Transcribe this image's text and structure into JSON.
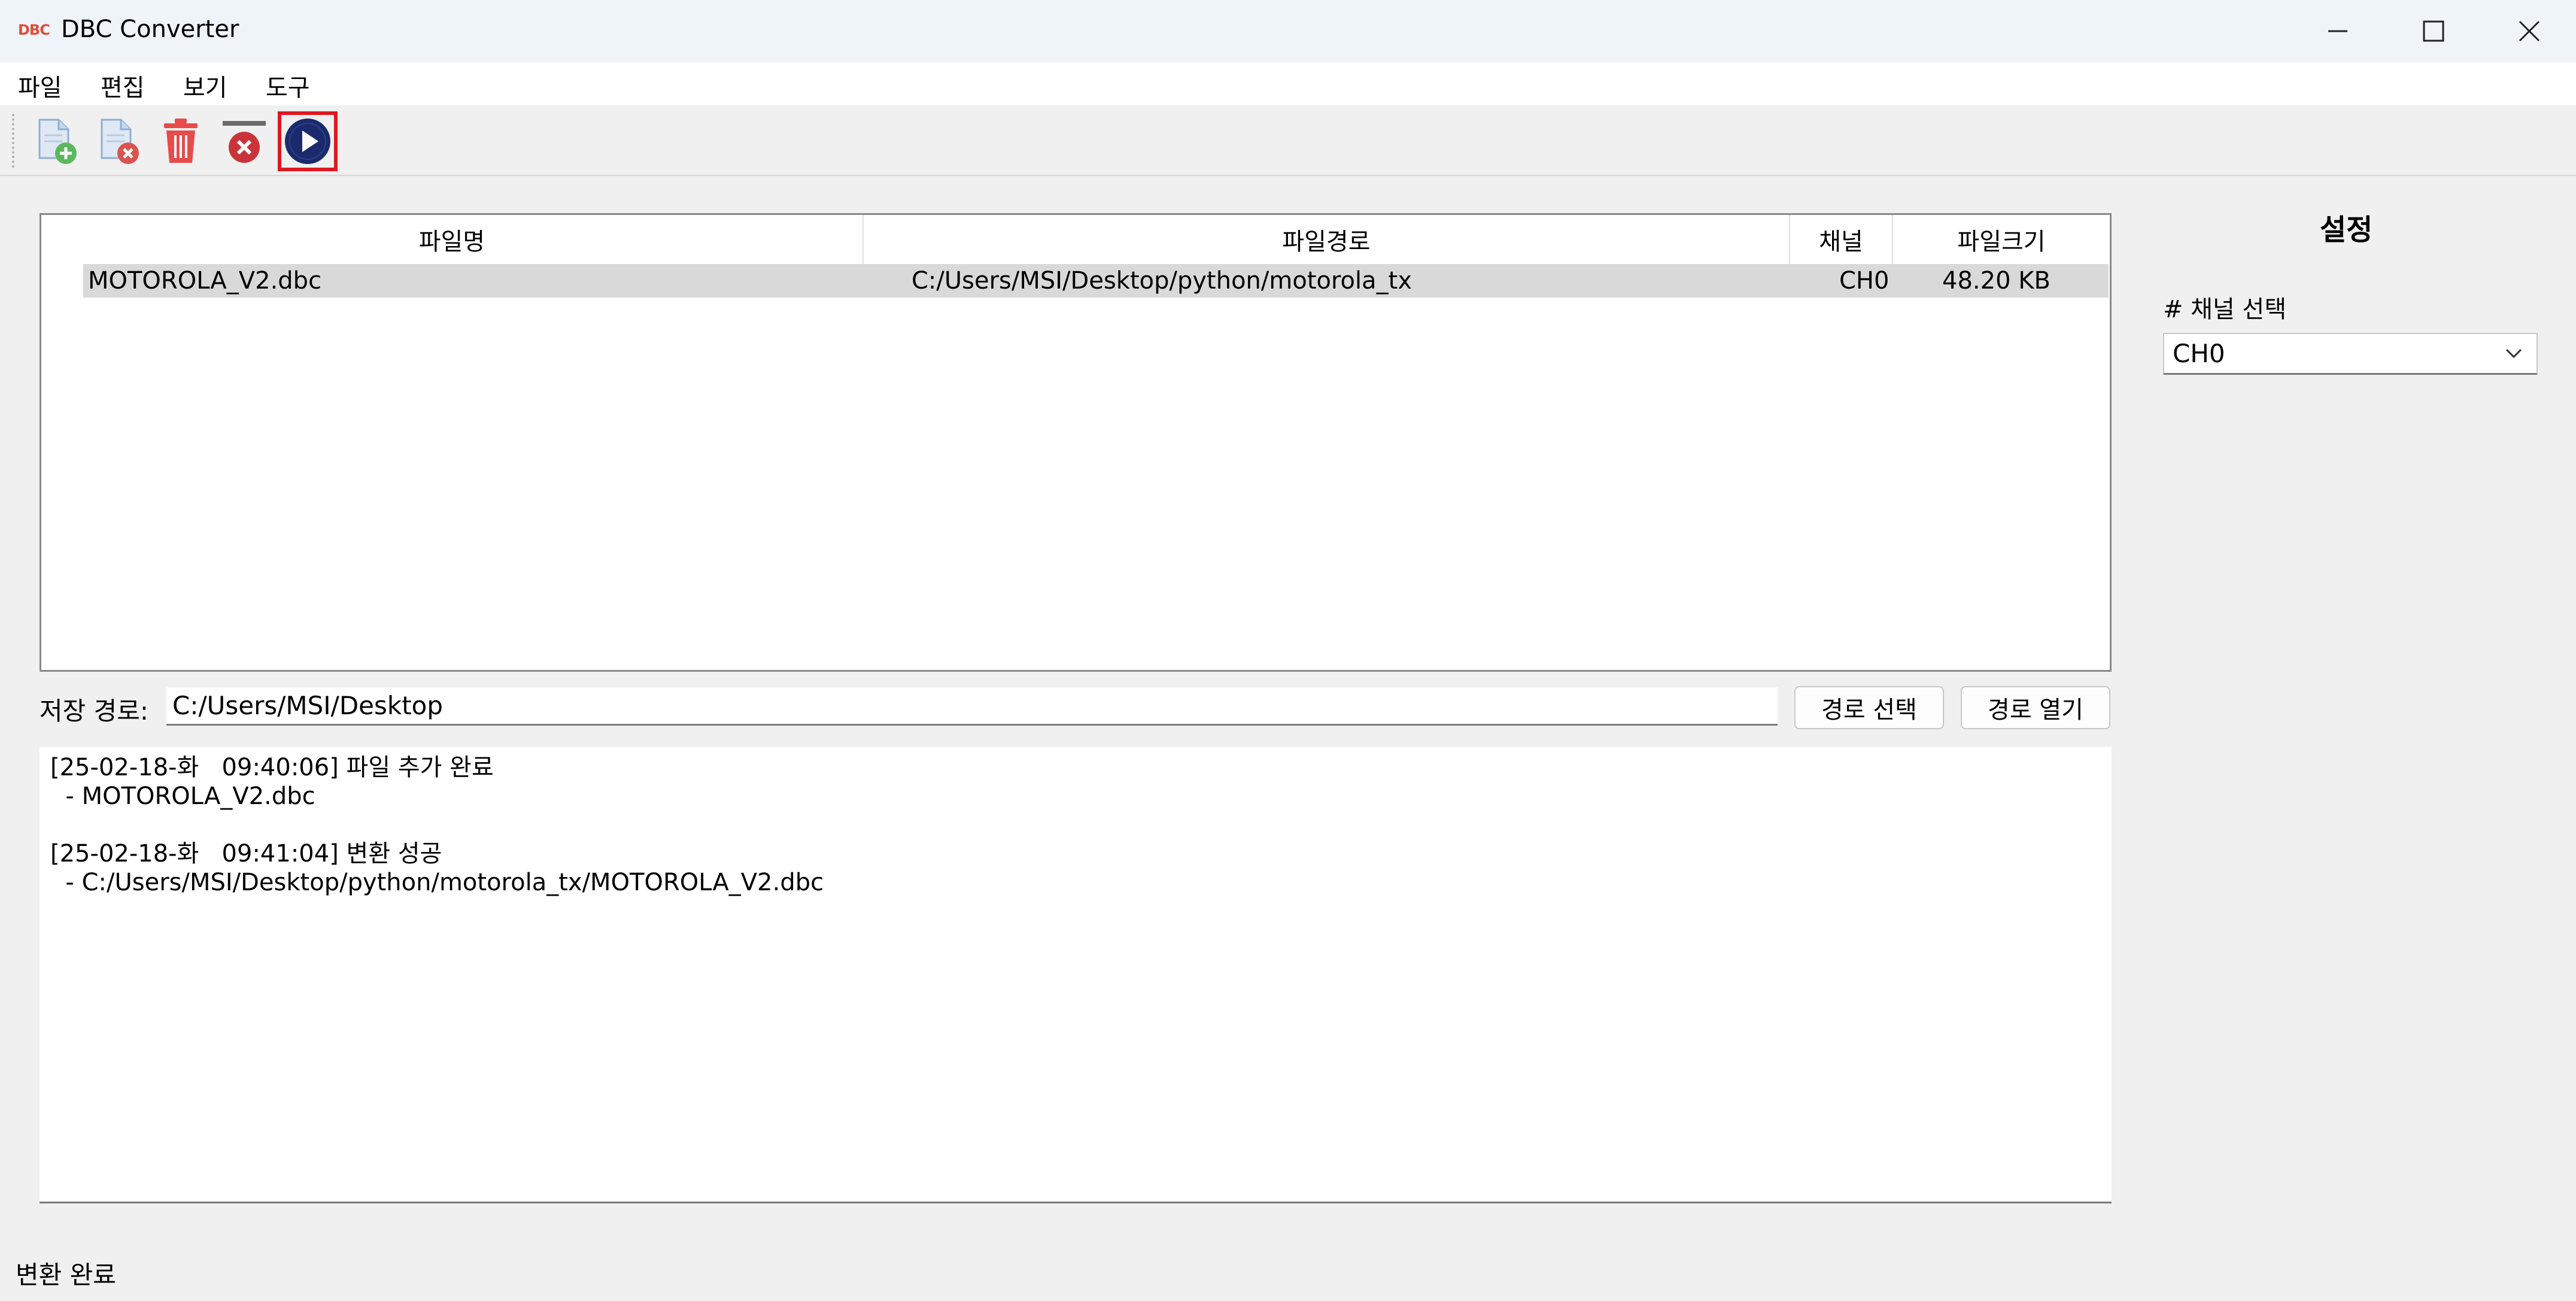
{
  "window": {
    "logo_text": "DBC",
    "title": "DBC Converter",
    "controls": [
      "minimize",
      "maximize",
      "close"
    ]
  },
  "menu": {
    "items": [
      {
        "label": "파일"
      },
      {
        "label": "편집"
      },
      {
        "label": "보기"
      },
      {
        "label": "도구"
      }
    ]
  },
  "toolbar": {
    "buttons": [
      {
        "icon": "add-file-icon"
      },
      {
        "icon": "remove-file-icon"
      },
      {
        "icon": "trash-icon"
      },
      {
        "icon": "clear-all-icon"
      },
      {
        "icon": "play-icon",
        "highlighted": true
      }
    ]
  },
  "table": {
    "columns": [
      "파일명",
      "파일경로",
      "채널",
      "파일크기"
    ],
    "rows": [
      {
        "name": "MOTOROLA_V2.dbc",
        "path": "C:/Users/MSI/Desktop/python/motorola_tx",
        "channel": "CH0",
        "size": "48.20 KB"
      }
    ]
  },
  "save": {
    "label": "저장 경로:",
    "path": "C:/Users/MSI/Desktop",
    "select_button": "경로 선택",
    "open_button": "경로 열기"
  },
  "log": {
    "lines": [
      "[25-02-18-화   09:40:06] 파일 추가 완료",
      "  - MOTOROLA_V2.dbc",
      "",
      "[25-02-18-화   09:41:04] 변환 성공",
      "  - C:/Users/MSI/Desktop/python/motorola_tx/MOTOROLA_V2.dbc"
    ]
  },
  "settings": {
    "title": "설정",
    "channel_label": "# 채널 선택",
    "channel_value": "CH0"
  },
  "status": {
    "text": "변환 완료"
  },
  "colors": {
    "accent_highlight": "#e0171f",
    "play_button": "#1a2a6c",
    "trash": "#e84b4b",
    "add_green": "#5cb85c",
    "remove_red": "#d9534f"
  }
}
